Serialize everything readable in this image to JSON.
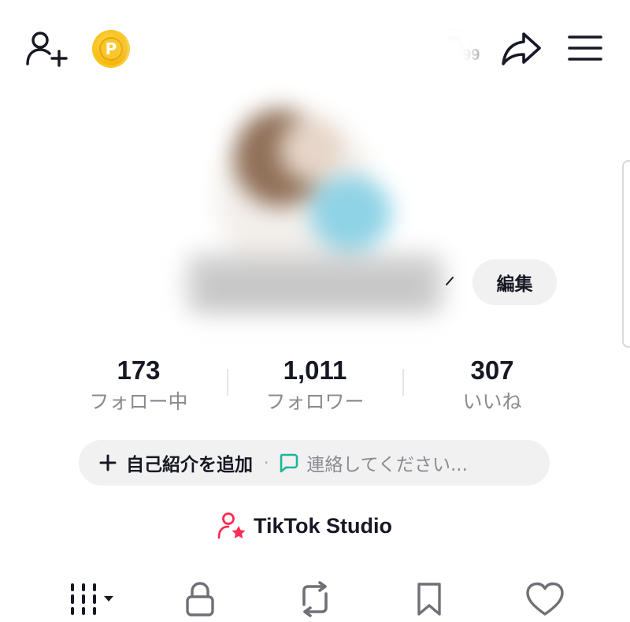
{
  "header": {
    "add_friend_icon": "person-plus-icon",
    "coin_icon": "coin-icon",
    "coin_letter": "P",
    "notification_count": "99",
    "share_icon": "share-arrow-icon",
    "menu_icon": "hamburger-menu-icon"
  },
  "profile": {
    "edit_label": "編集"
  },
  "stats": [
    {
      "value": "173",
      "label": "フォロー中"
    },
    {
      "value": "1,011",
      "label": "フォロワー"
    },
    {
      "value": "307",
      "label": "いいね"
    }
  ],
  "bio": {
    "add_label": "自己紹介を追加",
    "separator": "·",
    "contact_label": "連絡してください..."
  },
  "studio": {
    "label": "TikTok Studio"
  },
  "tabs": [
    {
      "name": "videos-grid",
      "icon": "grid-bars-icon"
    },
    {
      "name": "private",
      "icon": "lock-icon"
    },
    {
      "name": "reposts",
      "icon": "repost-icon"
    },
    {
      "name": "saved",
      "icon": "bookmark-icon"
    },
    {
      "name": "liked",
      "icon": "heart-icon"
    }
  ],
  "colors": {
    "text_primary": "#161823",
    "text_secondary": "#8a8b91",
    "pill_bg": "#f1f1f2",
    "coin": "#f6b90e",
    "contact_icon": "#20b49a",
    "studio_icon": "#fe2c55"
  }
}
